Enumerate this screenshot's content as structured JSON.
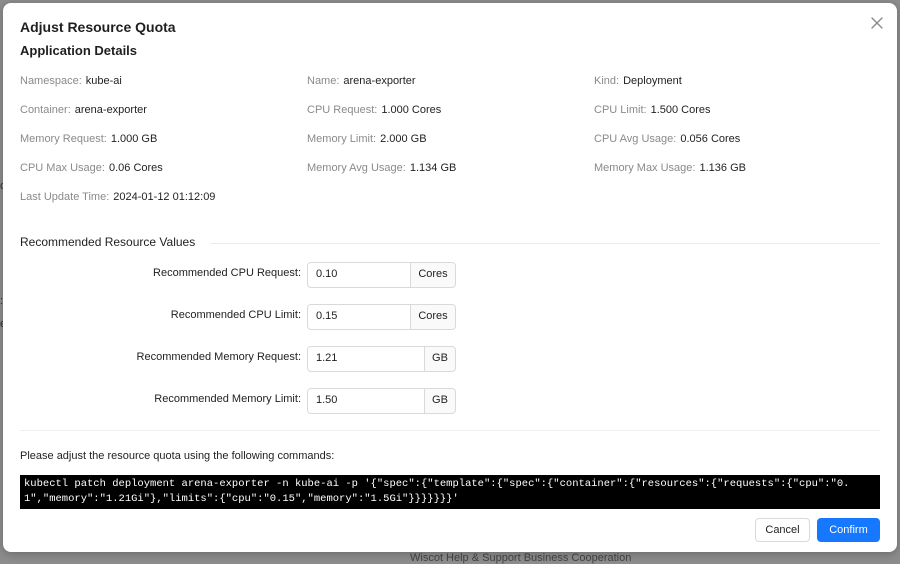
{
  "modal": {
    "title": "Adjust Resource Quota",
    "close_icon": "close-icon"
  },
  "details": {
    "heading": "Application Details",
    "items": [
      {
        "label": "Namespace",
        "value": "kube-ai"
      },
      {
        "label": "Name",
        "value": "arena-exporter"
      },
      {
        "label": "Kind",
        "value": "Deployment"
      },
      {
        "label": "Container",
        "value": "arena-exporter"
      },
      {
        "label": "CPU Request",
        "value": "1.000 Cores"
      },
      {
        "label": "CPU Limit",
        "value": "1.500 Cores"
      },
      {
        "label": "Memory Request",
        "value": "1.000 GB"
      },
      {
        "label": "Memory Limit",
        "value": "2.000 GB"
      },
      {
        "label": "CPU Avg Usage",
        "value": "0.056 Cores"
      },
      {
        "label": "CPU Max Usage",
        "value": "0.06 Cores"
      },
      {
        "label": "Memory Avg Usage",
        "value": "1.134 GB"
      },
      {
        "label": "Memory Max Usage",
        "value": "1.136 GB"
      },
      {
        "label": "Last Update Time",
        "value": "2024-01-12 01:12:09"
      }
    ]
  },
  "recommended": {
    "heading": "Recommended Resource Values",
    "fields": [
      {
        "label": "Recommended CPU Request",
        "value": "0.10",
        "unit": "Cores"
      },
      {
        "label": "Recommended CPU Limit",
        "value": "0.15",
        "unit": "Cores"
      },
      {
        "label": "Recommended Memory Request",
        "value": "1.21",
        "unit": "GB"
      },
      {
        "label": "Recommended Memory Limit",
        "value": "1.50",
        "unit": "GB"
      }
    ]
  },
  "command": {
    "instruction": "Please adjust the resource quota using the following commands:",
    "text": "kubectl patch deployment arena-exporter -n kube-ai -p '{\"spec\":{\"template\":{\"spec\":{\"container\":{\"resources\":{\"requests\":{\"cpu\":\"0.1\",\"memory\":\"1.21Gi\"},\"limits\":{\"cpu\":\"0.15\",\"memory\":\"1.5Gi\"}}}}}}}'"
  },
  "footer": {
    "cancel_label": "Cancel",
    "confirm_label": "Confirm"
  },
  "backdrop": {
    "footer_text": "Wiscot  Help & Support  Business Cooperation"
  },
  "colors": {
    "primary": "#1677ff",
    "command_bg": "#000000"
  }
}
